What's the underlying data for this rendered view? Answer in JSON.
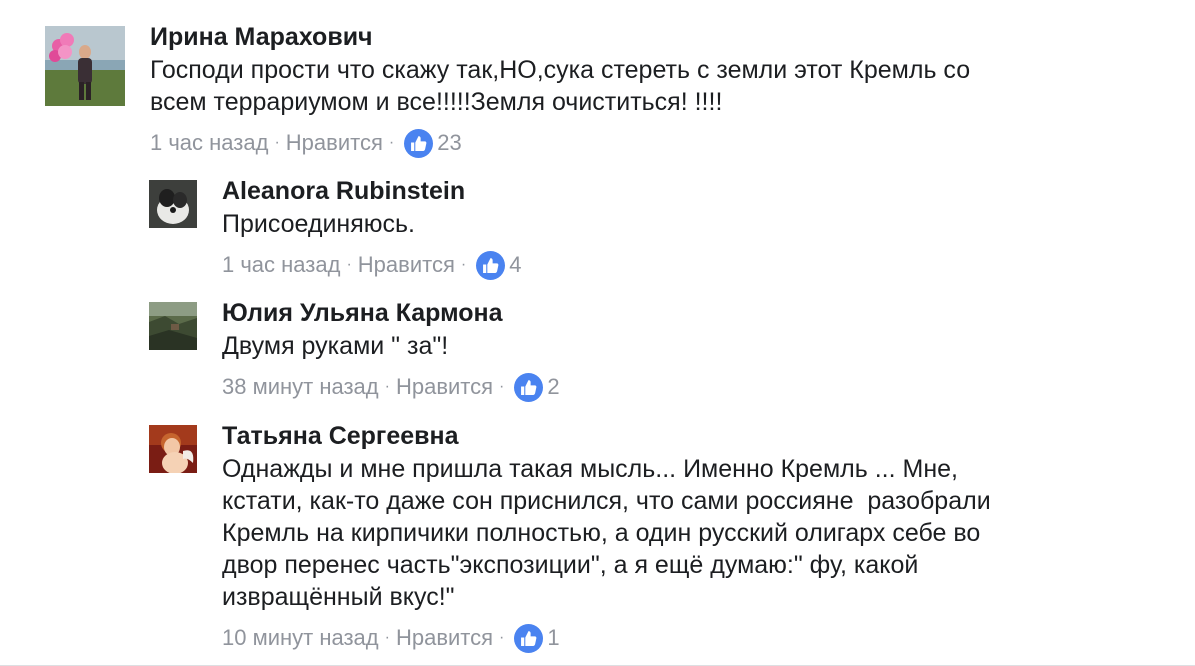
{
  "comments": [
    {
      "author": "Ирина Марахович",
      "text": "Господи прости что скажу так,НО,сука стереть с земли этот Кремль со\nвсем террариумом и все!!!!!Земля очиститься! !!!!",
      "time": "1 час назад",
      "like_label": "Нравится",
      "likes": "23",
      "avatar_icon": "photo-woman-balloons"
    },
    {
      "author": "Aleanora Rubinstein",
      "text": "Присоединяюсь.",
      "time": "1 час назад",
      "like_label": "Нравится",
      "likes": "4",
      "avatar_icon": "photo-dog"
    },
    {
      "author": "Юлия Ульяна Кармона",
      "text": "Двумя руками \" за\"!",
      "time": "38 минут назад",
      "like_label": "Нравится",
      "likes": "2",
      "avatar_icon": "photo-landscape"
    },
    {
      "author": "Татьяна Сергеевна",
      "text": "Однажды и мне пришла такая мысль... Именно Кремль ... Мне,\nкстати, как-то даже сон приснился, что сами россияне  разобрали\nКремль на кирпичики полностью, а один русский олигарх себе во\nдвор перенес часть\"экспозиции\", а я ещё думаю:\" фу, какой\nизвращённый вкус!\"",
      "time": "10 минут назад",
      "like_label": "Нравится",
      "likes": "1",
      "avatar_icon": "photo-cupid"
    }
  ],
  "separator": "·",
  "colors": {
    "like_badge": "#4a83f0",
    "meta_text": "#90949c",
    "author_text": "#1c1e21"
  }
}
